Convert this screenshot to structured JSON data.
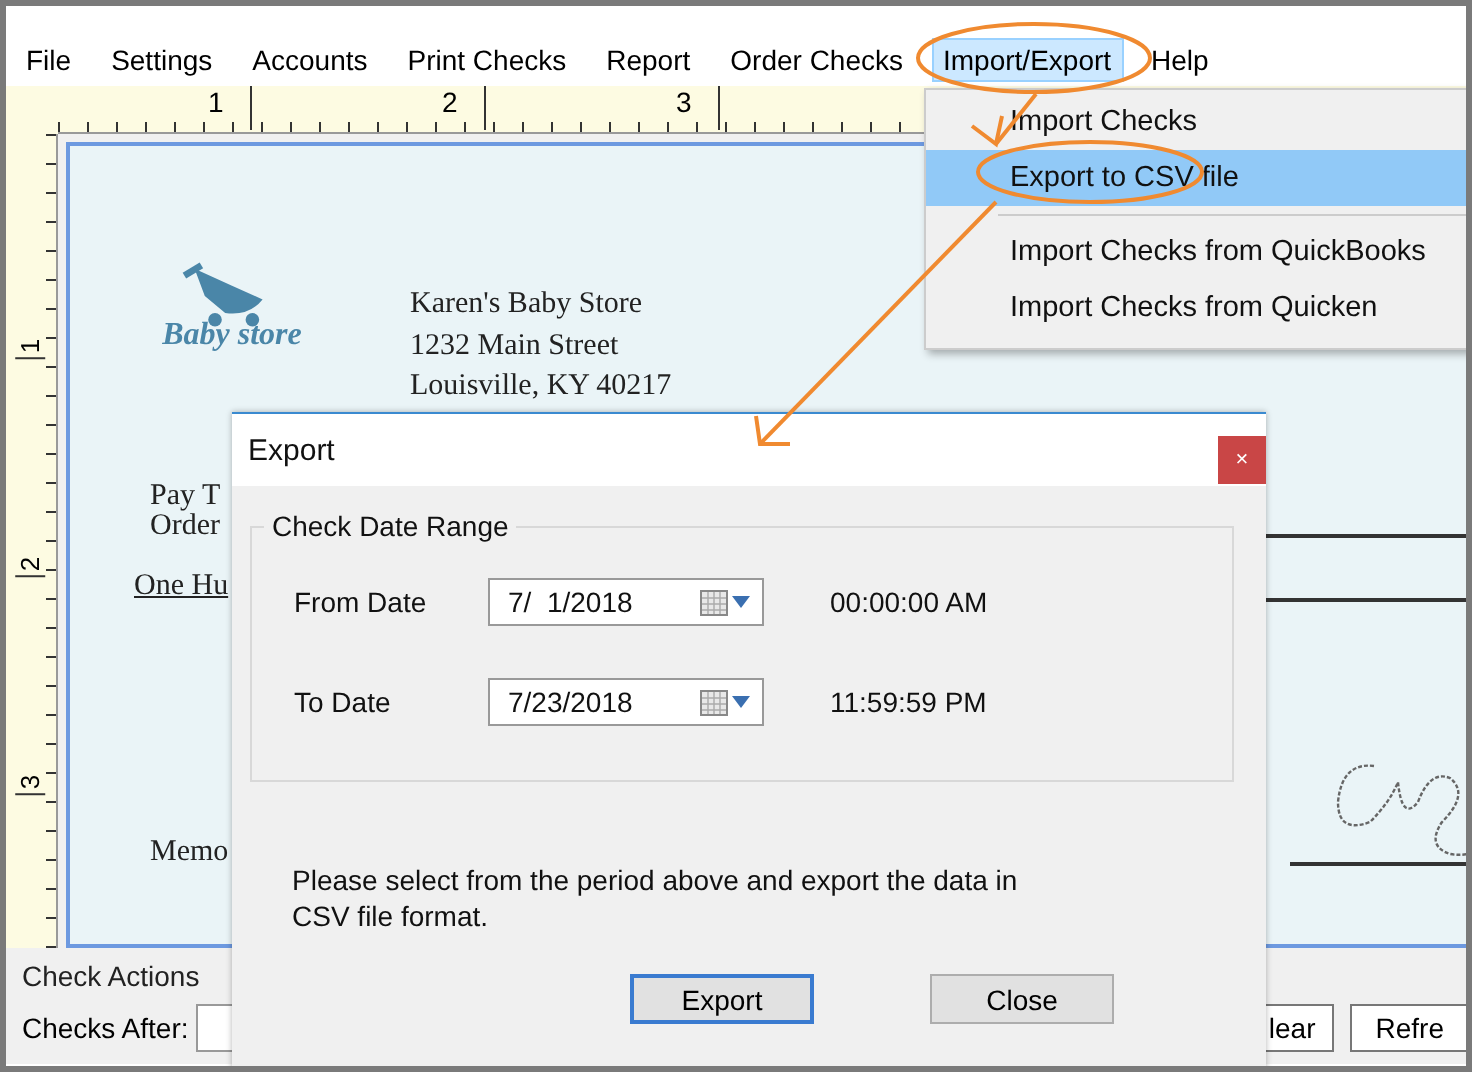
{
  "menu_bar": [
    {
      "label": "File",
      "selected": false
    },
    {
      "label": "Settings",
      "selected": false
    },
    {
      "label": "Accounts",
      "selected": false
    },
    {
      "label": "Print Checks",
      "selected": false
    },
    {
      "label": "Report",
      "selected": false
    },
    {
      "label": "Order Checks",
      "selected": false
    },
    {
      "label": "Import/Export",
      "selected": true
    },
    {
      "label": "Help",
      "selected": false
    }
  ],
  "ruler": {
    "marks": [
      "1",
      "2",
      "3"
    ]
  },
  "vertical_ruler": {
    "marks": [
      "1",
      "2",
      "3"
    ]
  },
  "check": {
    "logo_text": "Baby store",
    "company_lines": [
      "Karen's Baby Store",
      "1232 Main Street",
      "Louisville, KY 40217"
    ],
    "pay_to": "Pay T",
    "order": "Order",
    "amount_words": "One Hu",
    "memo": "Memo"
  },
  "dropdown": {
    "items": [
      {
        "kind": "item",
        "label": "Import Checks",
        "selected": false
      },
      {
        "kind": "item",
        "label": "Export to CSV file",
        "selected": true
      },
      {
        "kind": "separator"
      },
      {
        "kind": "item",
        "label": "Import Checks from QuickBooks",
        "selected": false
      },
      {
        "kind": "item",
        "label": "Import Checks from Quicken",
        "selected": false
      }
    ]
  },
  "check_actions": {
    "title": "Check Actions",
    "checks_after_label": "Checks After:",
    "buttons": [
      "lear",
      "Refre"
    ]
  },
  "dialog": {
    "title": "Export",
    "close": "×",
    "group_title": "Check Date Range",
    "rows": [
      {
        "label": "From Date",
        "value": "7/  1/2018",
        "time": "00:00:00 AM"
      },
      {
        "label": "To Date",
        "value": "7/23/2018",
        "time": "11:59:59 PM"
      }
    ],
    "message": "Please select from the period above and export the data in CSV file format.",
    "buttons": [
      {
        "label": "Export",
        "default": true
      },
      {
        "label": "Close",
        "default": false
      }
    ]
  }
}
